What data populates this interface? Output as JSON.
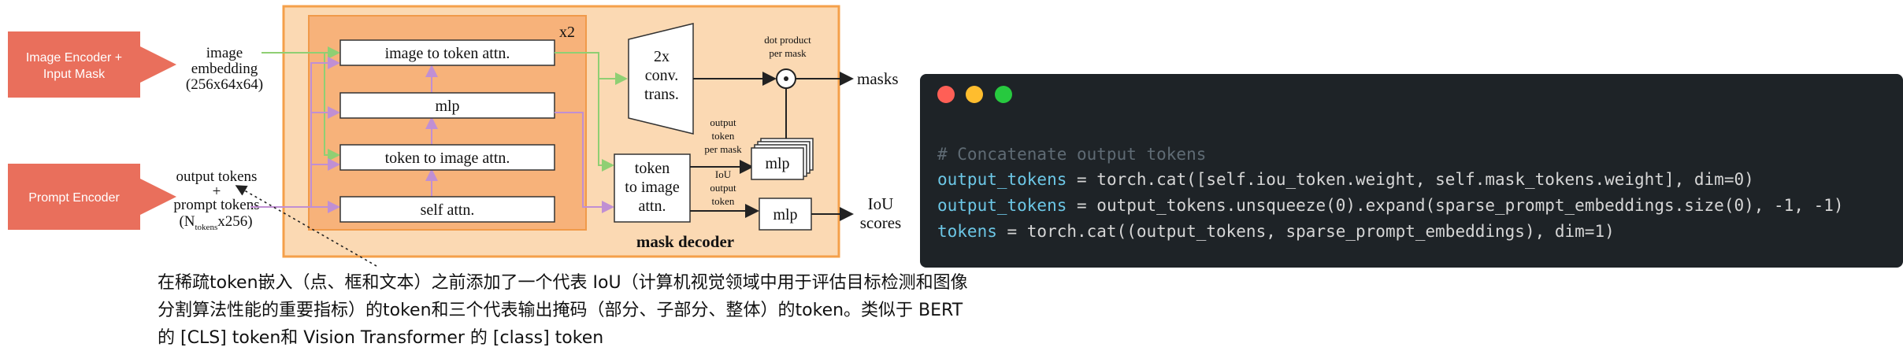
{
  "colors": {
    "input_box": "#e96f5c",
    "outer_block": "#fbd9b3",
    "inner_block": "#f7b27a",
    "green_arrow": "#8fcf73",
    "purple_arrow": "#c08fd3",
    "code_bg": "#1e2327",
    "code_comment": "#5f6b74",
    "code_variable": "#6cc7e6",
    "code_text": "#d6d6d6",
    "window_red": "#ff5f56",
    "window_yellow": "#ffbd2e",
    "window_green": "#27c93f"
  },
  "diagram": {
    "image_encoder_label": [
      "Image Encoder +",
      "Input Mask"
    ],
    "prompt_encoder_label": "Prompt Encoder",
    "image_embedding_label": [
      "image",
      "embedding",
      "(256x64x64)"
    ],
    "output_tokens_label": [
      "output tokens",
      "+",
      "prompt tokens"
    ],
    "tokens_shape_label": {
      "prefix": "(N",
      "subscript": "tokens",
      "suffix": "x256)"
    },
    "repeat_label": "x2",
    "blocks": {
      "image_to_token": "image to token attn.",
      "mlp": "mlp",
      "token_to_image": "token to image attn.",
      "self_attn": "self attn."
    },
    "conv_label": [
      "2x",
      "conv.",
      "trans."
    ],
    "token_to_image_final": [
      "token",
      "to image",
      "attn."
    ],
    "dot_product_label": [
      "dot product",
      "per mask"
    ],
    "output_token_per_mask_label": [
      "output",
      "token",
      "per mask"
    ],
    "iou_output_token_label": [
      "IoU",
      "output",
      "token"
    ],
    "mlp_mask": "mlp",
    "mlp_iou": "mlp",
    "masks_label": "masks",
    "iou_scores_label": [
      "IoU",
      "scores"
    ],
    "mask_decoder_label": "mask decoder"
  },
  "annotation": {
    "lines": [
      "在稀疏token嵌入（点、框和文本）之前添加了一个代表 IoU（计算机视觉领域中用于评估目标检测和图像",
      "分割算法性能的重要指标）的token和三个代表输出掩码（部分、子部分、整体）的token。类似于 BERT",
      "的 [CLS] token和 Vision Transformer 的 [class] token"
    ]
  },
  "code": {
    "comment": "# Concatenate output tokens",
    "lines": [
      {
        "var": "output_tokens",
        "rest": " = torch.cat([self.iou_token.weight, self.mask_tokens.weight], dim=0)"
      },
      {
        "var": "output_tokens",
        "rest": " = output_tokens.unsqueeze(0).expand(sparse_prompt_embeddings.size(0), -1, -1)"
      },
      {
        "var": "tokens",
        "rest": " = torch.cat((output_tokens, sparse_prompt_embeddings), dim=1)"
      }
    ]
  }
}
